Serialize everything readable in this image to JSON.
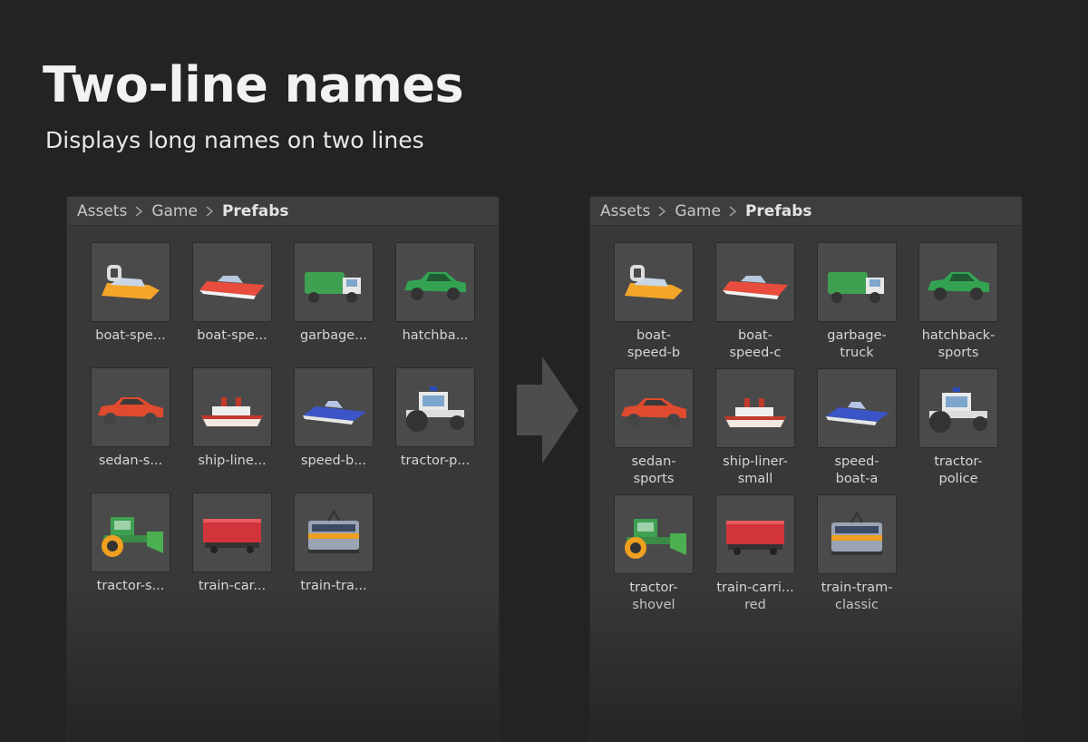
{
  "header": {
    "title": "Two-line names",
    "subtitle": "Displays long names on two lines"
  },
  "breadcrumb": {
    "items": [
      "Assets",
      "Game"
    ],
    "current": "Prefabs"
  },
  "left_panel": {
    "labels": [
      "boat-spe...",
      "boat-spe...",
      "garbage...",
      "hatchba...",
      "sedan-s...",
      "ship-line...",
      "speed-b...",
      "tractor-p...",
      "tractor-s...",
      "train-car...",
      "train-tra..."
    ]
  },
  "right_panel": {
    "labels": [
      [
        "boat-",
        "speed-b"
      ],
      [
        "boat-",
        "speed-c"
      ],
      [
        "garbage-",
        "truck"
      ],
      [
        "hatchback-",
        "sports"
      ],
      [
        "sedan-",
        "sports"
      ],
      [
        "ship-liner-",
        "small"
      ],
      [
        "speed-",
        "boat-a"
      ],
      [
        "tractor-",
        "police"
      ],
      [
        "tractor-",
        "shovel"
      ],
      [
        "train-carri...",
        "red"
      ],
      [
        "train-tram-",
        "classic"
      ]
    ]
  },
  "icons": [
    "hovercraft-boat-icon",
    "speedboat-icon",
    "garbage-truck-icon",
    "hatchback-car-icon",
    "sedan-car-icon",
    "ship-liner-icon",
    "jet-boat-icon",
    "police-tractor-icon",
    "shovel-tractor-icon",
    "train-carriage-icon",
    "tram-icon"
  ],
  "colors": {
    "background": "#232325",
    "panel": "#383838",
    "thumbnail": "#4a4a4a"
  }
}
